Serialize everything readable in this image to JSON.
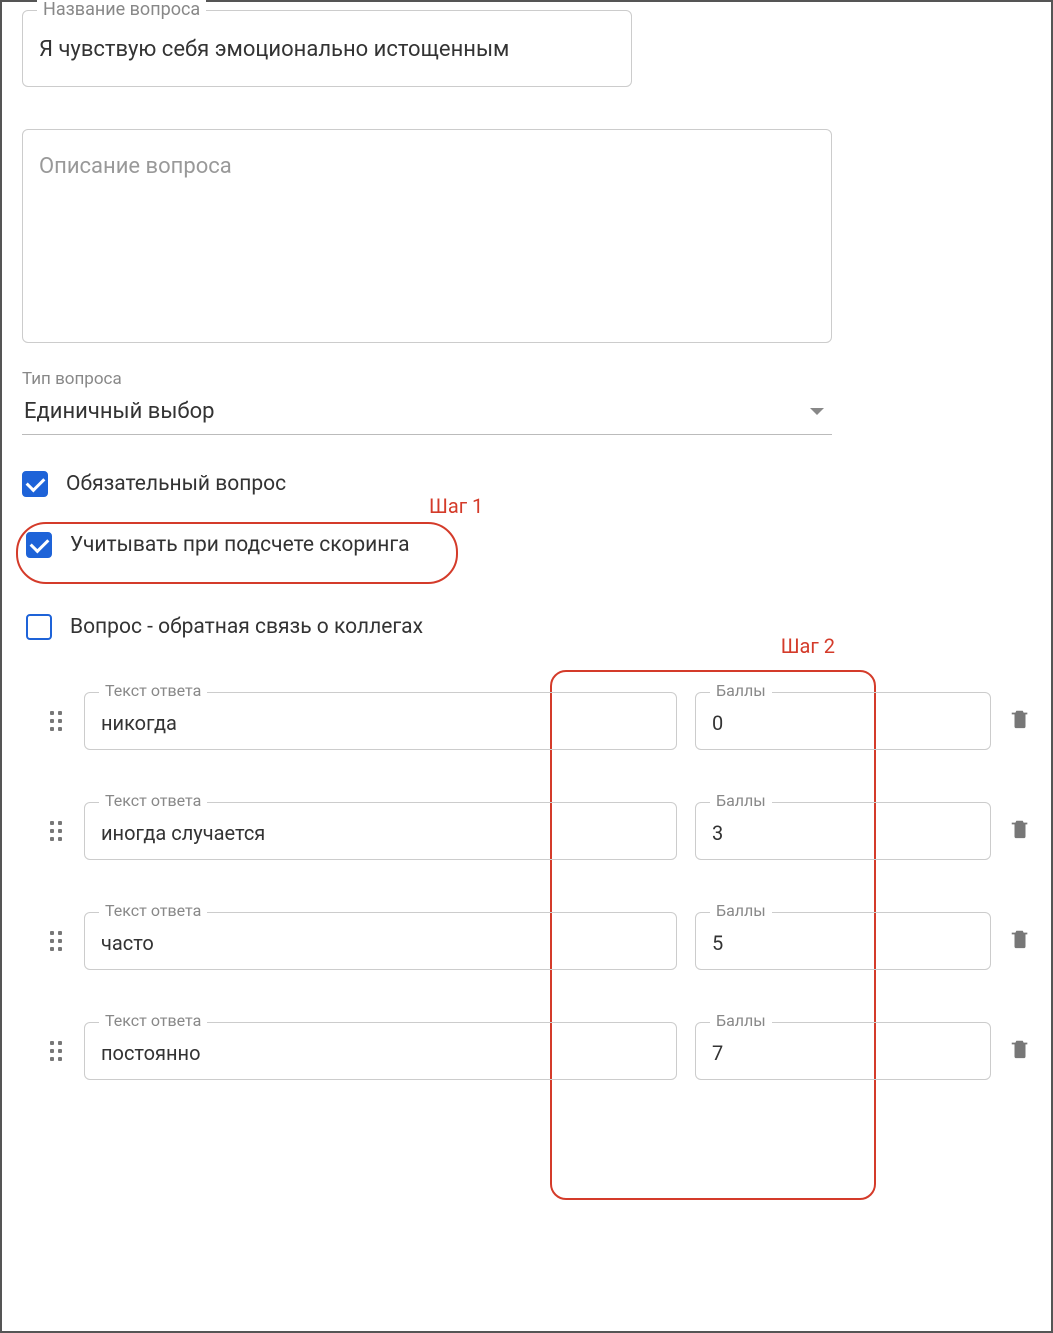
{
  "question_title_label": "Название вопроса",
  "question_title_value": "Я чувствую себя эмоционально истощенным",
  "question_description_label": "Описание вопроса",
  "question_description_value": "",
  "question_type_label": "Тип вопроса",
  "question_type_value": "Единичный выбор",
  "checkboxes": {
    "required": {
      "label": "Обязательный вопрос",
      "checked": true
    },
    "scoring": {
      "label": "Учитывать при подсчете скоринга",
      "checked": true
    },
    "feedback": {
      "label": "Вопрос - обратная связь о коллегах",
      "checked": false
    }
  },
  "annotations": {
    "step1": "Шаг 1",
    "step2": "Шаг 2"
  },
  "answer_text_label": "Текст ответа",
  "answer_score_label": "Баллы",
  "answers": [
    {
      "text": "никогда",
      "score": "0"
    },
    {
      "text": "иногда случается",
      "score": "3"
    },
    {
      "text": "часто",
      "score": "5"
    },
    {
      "text": "постоянно",
      "score": "7"
    }
  ]
}
